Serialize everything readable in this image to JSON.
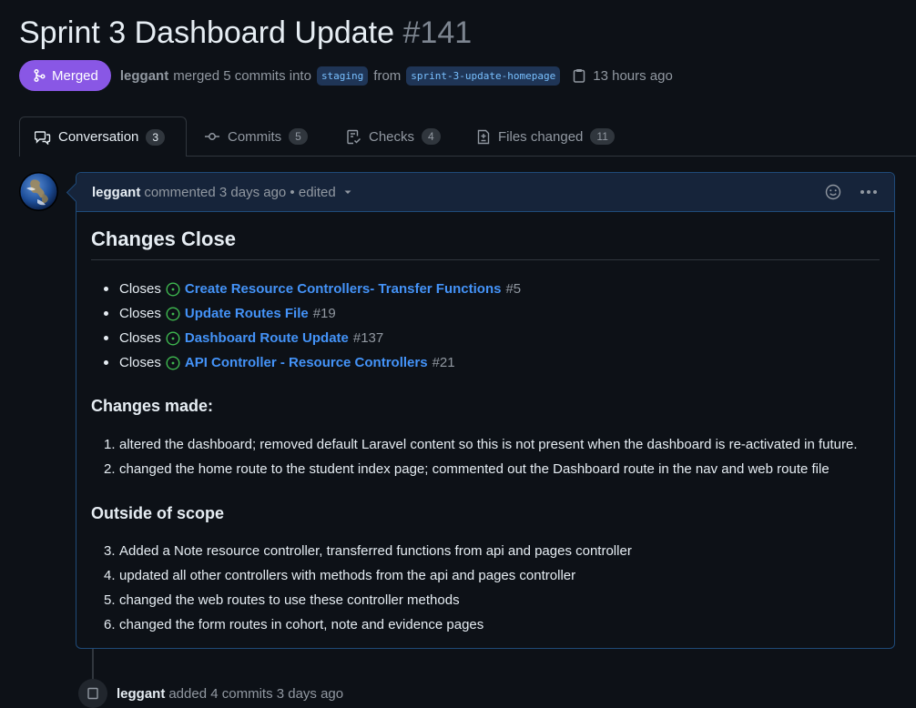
{
  "pr": {
    "title": "Sprint 3 Dashboard Update",
    "number": "#141",
    "state": "Merged",
    "author": "leggant",
    "merged_text": "merged 5 commits into",
    "base_branch": "staging",
    "from_text": "from",
    "head_branch": "sprint-3-update-homepage",
    "time": "13 hours ago"
  },
  "tabs": [
    {
      "label": "Conversation",
      "count": "3",
      "icon": "comment-discussion-icon"
    },
    {
      "label": "Commits",
      "count": "5",
      "icon": "git-commit-icon"
    },
    {
      "label": "Checks",
      "count": "4",
      "icon": "checklist-icon"
    },
    {
      "label": "Files changed",
      "count": "11",
      "icon": "file-diff-icon"
    }
  ],
  "comment": {
    "author": "leggant",
    "action": "commented 3 days ago • edited",
    "heading": "Changes Close",
    "closes": [
      {
        "prefix": "Closes",
        "title": "Create Resource Controllers- Transfer Functions",
        "ref": "#5"
      },
      {
        "prefix": "Closes",
        "title": "Update Routes File",
        "ref": "#19"
      },
      {
        "prefix": "Closes",
        "title": "Dashboard Route Update",
        "ref": "#137"
      },
      {
        "prefix": "Closes",
        "title": "API Controller - Resource Controllers",
        "ref": "#21"
      }
    ],
    "changes_heading": "Changes made:",
    "changes": [
      {
        "num": "1.",
        "text": "altered the dashboard; removed default Laravel content so this is not present when the dashboard is re-activated in future."
      },
      {
        "num": "2.",
        "text": "changed the home route to the student index page; commented out the Dashboard route in the nav and web route file"
      }
    ],
    "scope_heading": "Outside of scope",
    "scope": [
      {
        "num": "3.",
        "text": "Added a Note resource controller, transferred functions from api and pages controller"
      },
      {
        "num": "4.",
        "text": "updated all other controllers with methods from the api and pages controller"
      },
      {
        "num": "5.",
        "text": "changed the web routes to use these controller methods"
      },
      {
        "num": "6.",
        "text": "changed the form routes in cohort, note and evidence pages"
      }
    ]
  },
  "event": {
    "author": "leggant",
    "text": "added 4 commits 3 days ago"
  },
  "colors": {
    "background": "#0d1117",
    "merged": "#8957e5",
    "link": "#4493f8",
    "issue_open": "#3fb950"
  }
}
